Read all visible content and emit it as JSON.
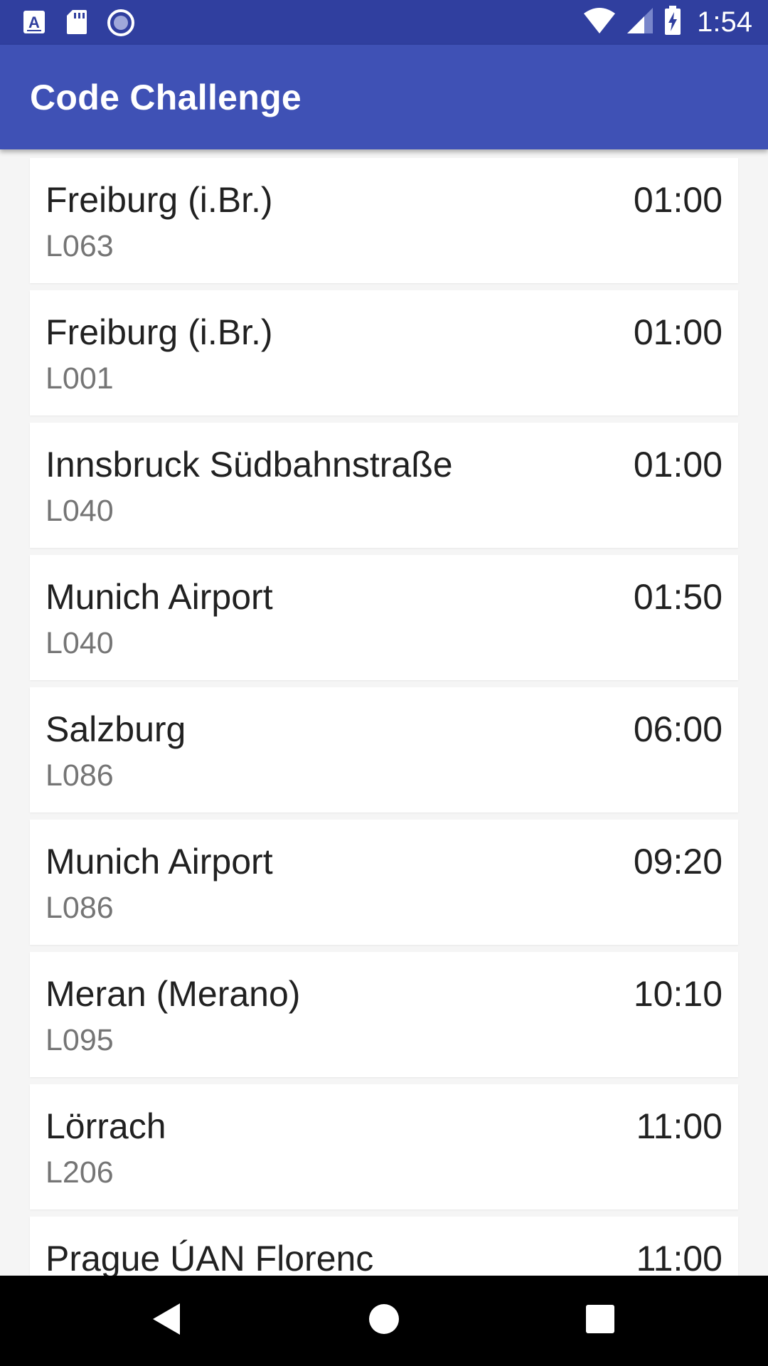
{
  "status_bar": {
    "time": "1:54",
    "icons_left": [
      "keyboard-a-icon",
      "sd-card-icon",
      "record-circle-icon"
    ],
    "icons_right": [
      "wifi-icon",
      "cell-signal-icon",
      "battery-charging-icon"
    ]
  },
  "app_bar": {
    "title": "Code Challenge",
    "color": "#3F51B5",
    "status_color": "#303F9F"
  },
  "connections": [
    {
      "destination": "Freiburg (i.Br.)",
      "line": "L063",
      "time": "01:00"
    },
    {
      "destination": "Freiburg (i.Br.)",
      "line": "L001",
      "time": "01:00"
    },
    {
      "destination": "Innsbruck Südbahnstraße",
      "line": "L040",
      "time": "01:00"
    },
    {
      "destination": "Munich Airport",
      "line": "L040",
      "time": "01:50"
    },
    {
      "destination": "Salzburg",
      "line": "L086",
      "time": "06:00"
    },
    {
      "destination": "Munich Airport",
      "line": "L086",
      "time": "09:20"
    },
    {
      "destination": "Meran (Merano)",
      "line": "L095",
      "time": "10:10"
    },
    {
      "destination": "Lörrach",
      "line": "L206",
      "time": "11:00"
    },
    {
      "destination": "Prague ÚAN Florenc",
      "line": "",
      "time": "11:00"
    }
  ],
  "nav_bar": {
    "buttons": [
      "back-icon",
      "home-icon",
      "recents-icon"
    ]
  }
}
